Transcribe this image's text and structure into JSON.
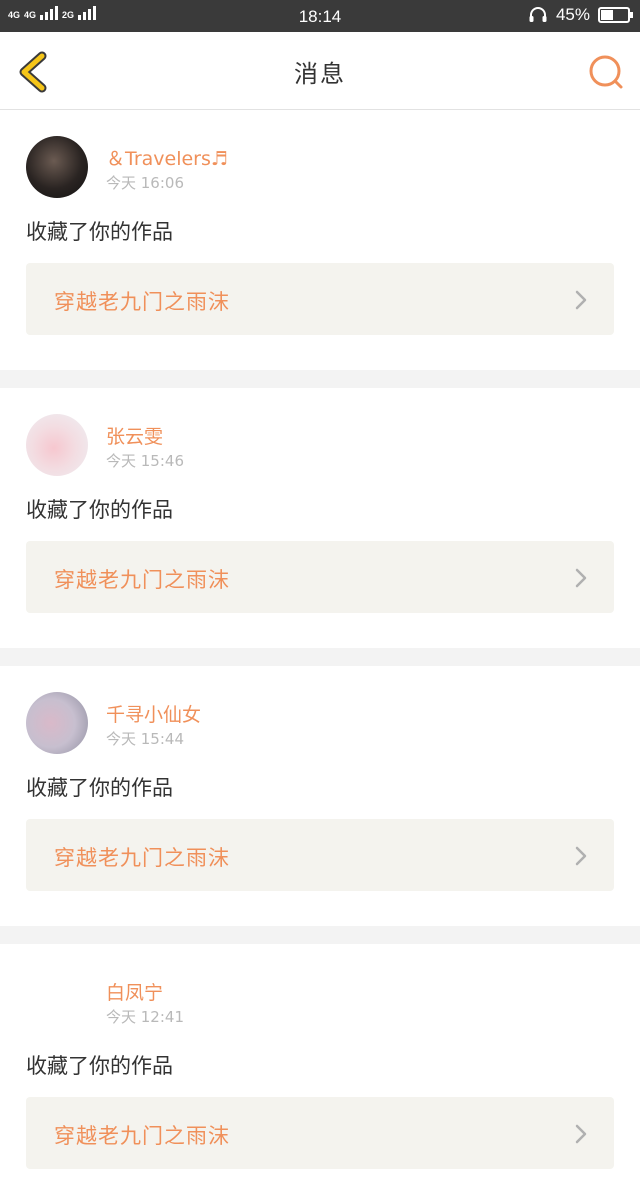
{
  "status_bar": {
    "net1": "4G",
    "net2": "4G",
    "net3": "2G",
    "time": "18:14",
    "battery_text": "45%",
    "battery_level": 0.45
  },
  "nav": {
    "title": "消息",
    "back_icon": "chevron-left-icon",
    "search_icon": "search-icon"
  },
  "colors": {
    "accent": "#f0905a",
    "back": "#f5c518",
    "text": "#333333",
    "muted": "#b9b9b9",
    "card_bg": "#f4f3ee"
  },
  "messages": [
    {
      "user": "＆Travelers♬",
      "time": "今天 16:06",
      "action": "收藏了你的作品",
      "work": "穿越老九门之雨沫"
    },
    {
      "user": "张云雯",
      "time": "今天 15:46",
      "action": "收藏了你的作品",
      "work": "穿越老九门之雨沫"
    },
    {
      "user": "千寻小仙女",
      "time": "今天 15:44",
      "action": "收藏了你的作品",
      "work": "穿越老九门之雨沫"
    },
    {
      "user": "白凤宁",
      "time": "今天 12:41",
      "action": "收藏了你的作品",
      "work": "穿越老九门之雨沫"
    }
  ]
}
